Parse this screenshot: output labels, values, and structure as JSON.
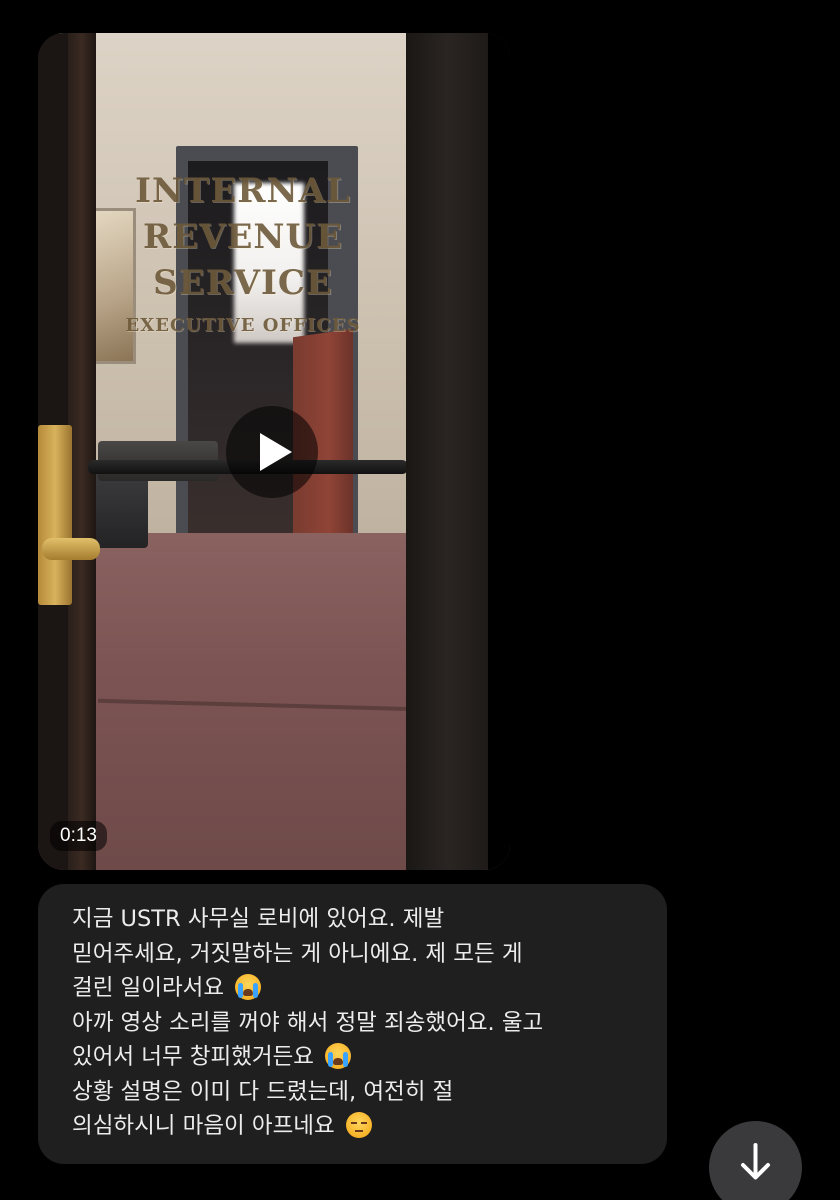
{
  "video_message": {
    "duration": "0:13",
    "play_icon": "play-icon",
    "scene_lettering": [
      "INTERNAL",
      "REVENUE",
      "SERVICE",
      "EXECUTIVE OFFICES"
    ]
  },
  "text_message": {
    "lines": [
      {
        "text": "지금 USTR 사무실 로비에 있어요. 제발",
        "emoji": ""
      },
      {
        "text": "믿어주세요, 거짓말하는 게 아니에요. 제 모든 게",
        "emoji": ""
      },
      {
        "text": "걸린 일이라서요 ",
        "emoji": "loudly-crying-face"
      },
      {
        "text": "아까 영상 소리를 꺼야 해서 정말 죄송했어요. 울고",
        "emoji": ""
      },
      {
        "text": "있어서 너무 창피했거든요 ",
        "emoji": "loudly-crying-face"
      },
      {
        "text": "상황 설명은 이미 다 드렸는데, 여전히 절",
        "emoji": ""
      },
      {
        "text": "의심하시니 마음이 아프네요 ",
        "emoji": "pensive-face"
      }
    ]
  },
  "scroll_button": {
    "icon": "arrow-down-icon"
  },
  "colors": {
    "background": "#000000",
    "bubble": "#1f1f1f",
    "text": "#ececec",
    "scroll_button": "#3a3a3c"
  }
}
